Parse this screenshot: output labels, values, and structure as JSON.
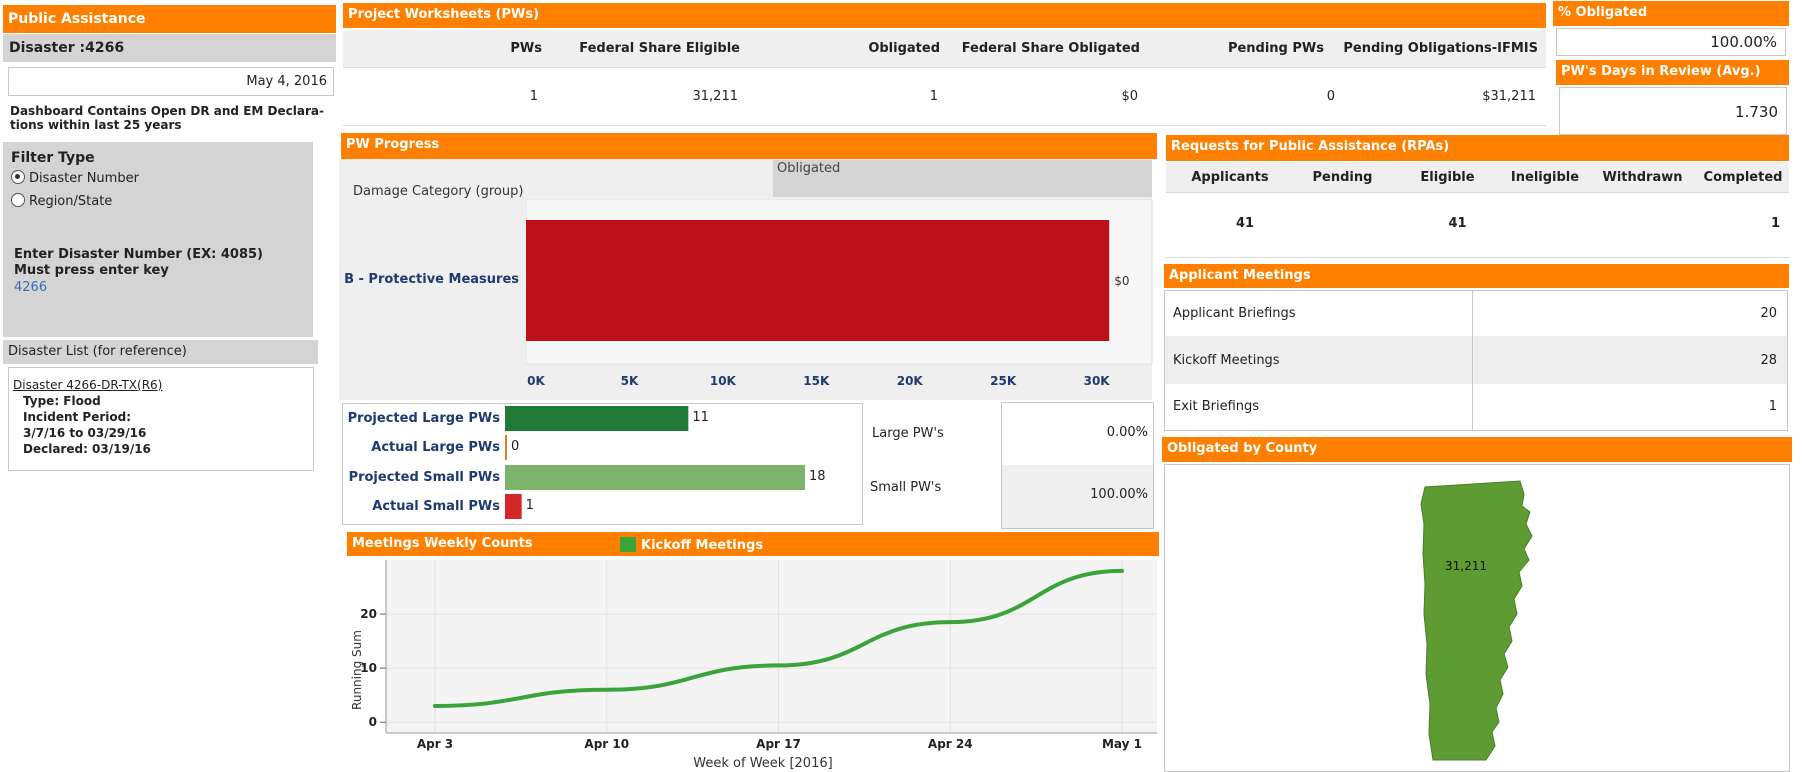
{
  "sidebar": {
    "title": "Public Assistance",
    "disaster_heading": "Disaster :4266",
    "date": "May 4, 2016",
    "description": "Dashboard Contains Open DR and EM Declara-tions within last 25 years",
    "filter_title": "Filter Type",
    "filter_options": [
      {
        "label": "Disaster Number",
        "selected": true
      },
      {
        "label": "Region/State",
        "selected": false
      }
    ],
    "enter_label_1": "Enter Disaster Number (EX: 4085)",
    "enter_label_2": "Must press enter key",
    "disaster_input_value": "4266",
    "list_header": "Disaster List (for reference)",
    "list_link": "Disaster 4266-DR-TX(R6)",
    "list_type": "Type: Flood",
    "list_incident_label": "Incident Period:",
    "list_incident_range": "3/7/16 to 03/29/16",
    "list_declared": "Declared: 03/19/16"
  },
  "pws": {
    "header": "Project Worksheets (PWs)",
    "columns": [
      "PWs",
      "Federal Share Eligible",
      "Obligated",
      "Federal Share Obligated",
      "Pending PWs",
      "Pending Obligations-IFMIS"
    ],
    "values": [
      "1",
      "31,211",
      "1",
      "$0",
      "0",
      "$31,211"
    ]
  },
  "pct_obligated": {
    "header": "% Obligated",
    "value": "100.00%"
  },
  "days_review": {
    "header": "PW's Days in Review (Avg.)",
    "value": "1.730"
  },
  "pw_progress": {
    "header": "PW Progress",
    "col_header": "Obligated",
    "row_header": "Damage Category (group)",
    "category": "B - Protective Measures",
    "bar_label": "$0",
    "color": "#be1019",
    "axis_ticks": [
      "0K",
      "5K",
      "10K",
      "15K",
      "20K",
      "25K",
      "30K"
    ]
  },
  "chart_data": [
    {
      "type": "bar",
      "orientation": "horizontal",
      "categories": [
        "B - Protective Measures"
      ],
      "values": [
        31211
      ],
      "xlim": [
        0,
        33500
      ]
    },
    {
      "type": "bar",
      "orientation": "horizontal",
      "categories": [
        "Projected Large PWs",
        "Actual Large PWs",
        "Projected Small PWs",
        "Actual Small PWs"
      ],
      "values": [
        11,
        0,
        18,
        1
      ],
      "colors": [
        "#1e7a35",
        "#e87722",
        "#7db36b",
        "#d62728"
      ],
      "xlim": [
        0,
        19.8
      ]
    },
    {
      "type": "line",
      "title": "Meetings Weekly Counts",
      "x": [
        "Apr 3",
        "Apr 10",
        "Apr 17",
        "Apr 24",
        "May 1"
      ],
      "series": [
        {
          "name": "Kickoff Meetings",
          "values": [
            3,
            6,
            10.5,
            18.5,
            28
          ]
        }
      ],
      "xlabel": "Week of Week [2016]",
      "ylabel": "Running Sum",
      "ylim": [
        -2,
        30
      ],
      "yticks": [
        0,
        10,
        20
      ],
      "grid": true
    }
  ],
  "pw_counts": {
    "rows": [
      {
        "label": "Projected Large PWs",
        "value": "11"
      },
      {
        "label": "Actual Large PWs",
        "value": "0"
      },
      {
        "label": "Projected Small PWs",
        "value": "18"
      },
      {
        "label": "Actual Small PWs",
        "value": "1"
      }
    ],
    "large_label": "Large PW's",
    "large_value": "0.00%",
    "small_label": "Small PW's",
    "small_value": "100.00%"
  },
  "meetings_chart": {
    "header": "Meetings Weekly Counts",
    "legend": "Kickoff Meetings",
    "color": "#3aa33a",
    "ylabel": "Running Sum",
    "xlabel": "Week of Week [2016]",
    "xticks": [
      "Apr 3",
      "Apr 10",
      "Apr 17",
      "Apr 24",
      "May 1"
    ],
    "yticks": [
      "0",
      "10",
      "20"
    ]
  },
  "rpa": {
    "header": "Requests for Public Assistance (RPAs)",
    "columns": [
      "Applicants",
      "Pending",
      "Eligible",
      "Ineligible",
      "Withdrawn",
      "Completed"
    ],
    "values": [
      "41",
      "",
      "41",
      "",
      "",
      "1"
    ]
  },
  "applicant_meetings": {
    "header": "Applicant Meetings",
    "rows": [
      {
        "label": "Applicant Briefings",
        "value": "20"
      },
      {
        "label": "Kickoff Meetings",
        "value": "28"
      },
      {
        "label": "Exit Briefings",
        "value": "1"
      }
    ]
  },
  "county": {
    "header": "Obligated by County",
    "value": "31,211",
    "color": "#5e9b33"
  }
}
